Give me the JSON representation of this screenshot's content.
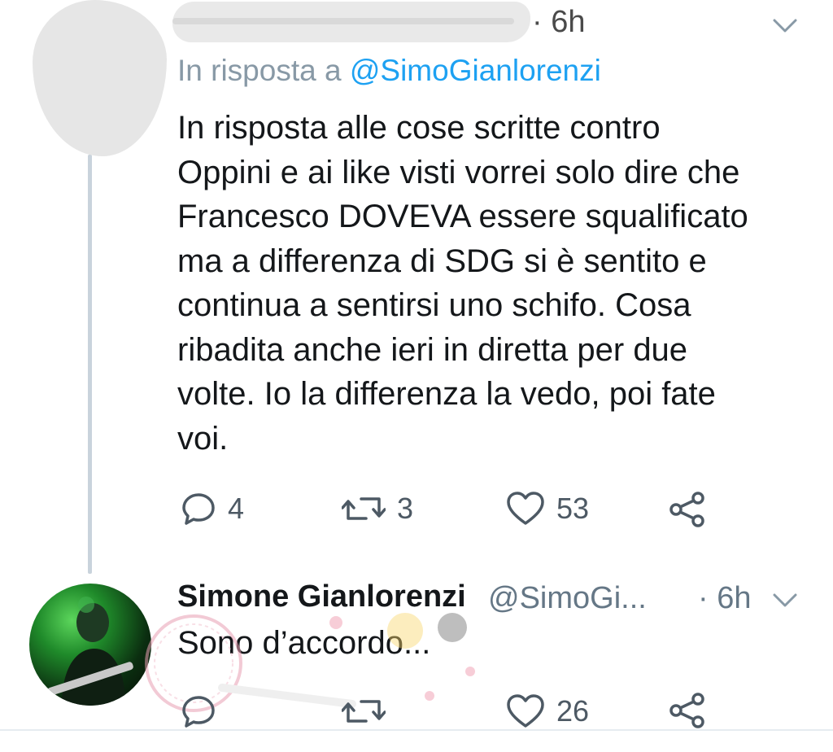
{
  "tweet1": {
    "time": "· 6h",
    "reply_to_prefix": "In risposta a ",
    "reply_to_handle": "@SimoGianlorenzi",
    "text": "In risposta alle cose scritte contro\nOppini e ai like visti vorrei solo dire che\nFrancesco DOVEVA essere squalificato\nma a differenza di SDG si è sentito e\ncontinua a sentirsi uno schifo. Cosa\nribadita anche ieri in diretta per due\nvolte. Io la differenza la vedo, poi fate\nvoi.",
    "replies": "4",
    "retweets": "3",
    "likes": "53"
  },
  "tweet2": {
    "name": "Simone Gianlorenzi",
    "handle": "@SimoGi...",
    "time": "· 6h",
    "text": "Sono d’accordo...",
    "likes": "26"
  },
  "icons": {
    "more": "chevron-down-icon",
    "reply": "speech-bubble-icon",
    "retweet": "retweet-icon",
    "like": "heart-icon",
    "share": "share-icon"
  },
  "colors": {
    "mention": "#1da1f2",
    "secondary_text": "#8899a6",
    "action_icon": "#4d5964",
    "thread_line": "#c9d3dc"
  }
}
